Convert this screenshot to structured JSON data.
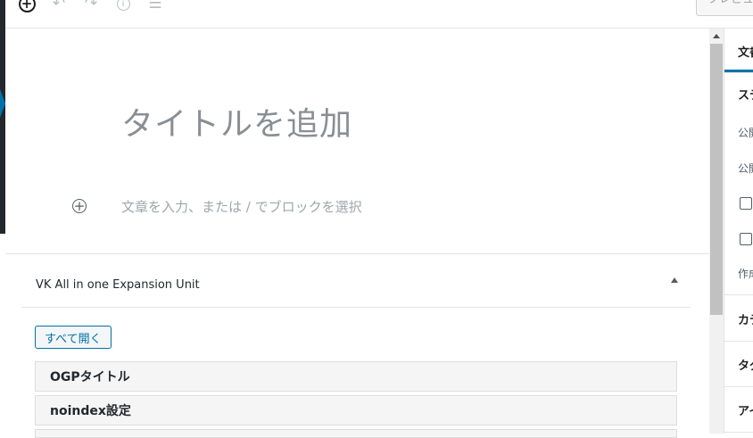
{
  "toolbar": {
    "icons": [
      "add-block-icon",
      "undo-icon",
      "redo-icon",
      "info-icon",
      "block-navigation-icon"
    ],
    "preview_label": "プレビュー"
  },
  "editor": {
    "title_placeholder": "タイトルを追加",
    "block_placeholder": "文章を入力、または / でブロックを選択"
  },
  "meta_box": {
    "title": "VK All in one Expansion Unit",
    "expand_all_label": "すべて開く",
    "panels": [
      "OGPタイトル",
      "noindex設定"
    ]
  },
  "sidebar": {
    "tab_document": "文書",
    "status_heading": "ステータスと公開状態",
    "row_visibility": "公開",
    "row_publish": "公開",
    "row_author": "作成者",
    "section_categories": "カテゴリー",
    "section_tags": "タグ",
    "section_eyecatch": "アイキャッチ画像"
  },
  "colors": {
    "accent": "#0073aa",
    "admin_bar": "#23282d",
    "placeholder": "#8a8f94"
  }
}
